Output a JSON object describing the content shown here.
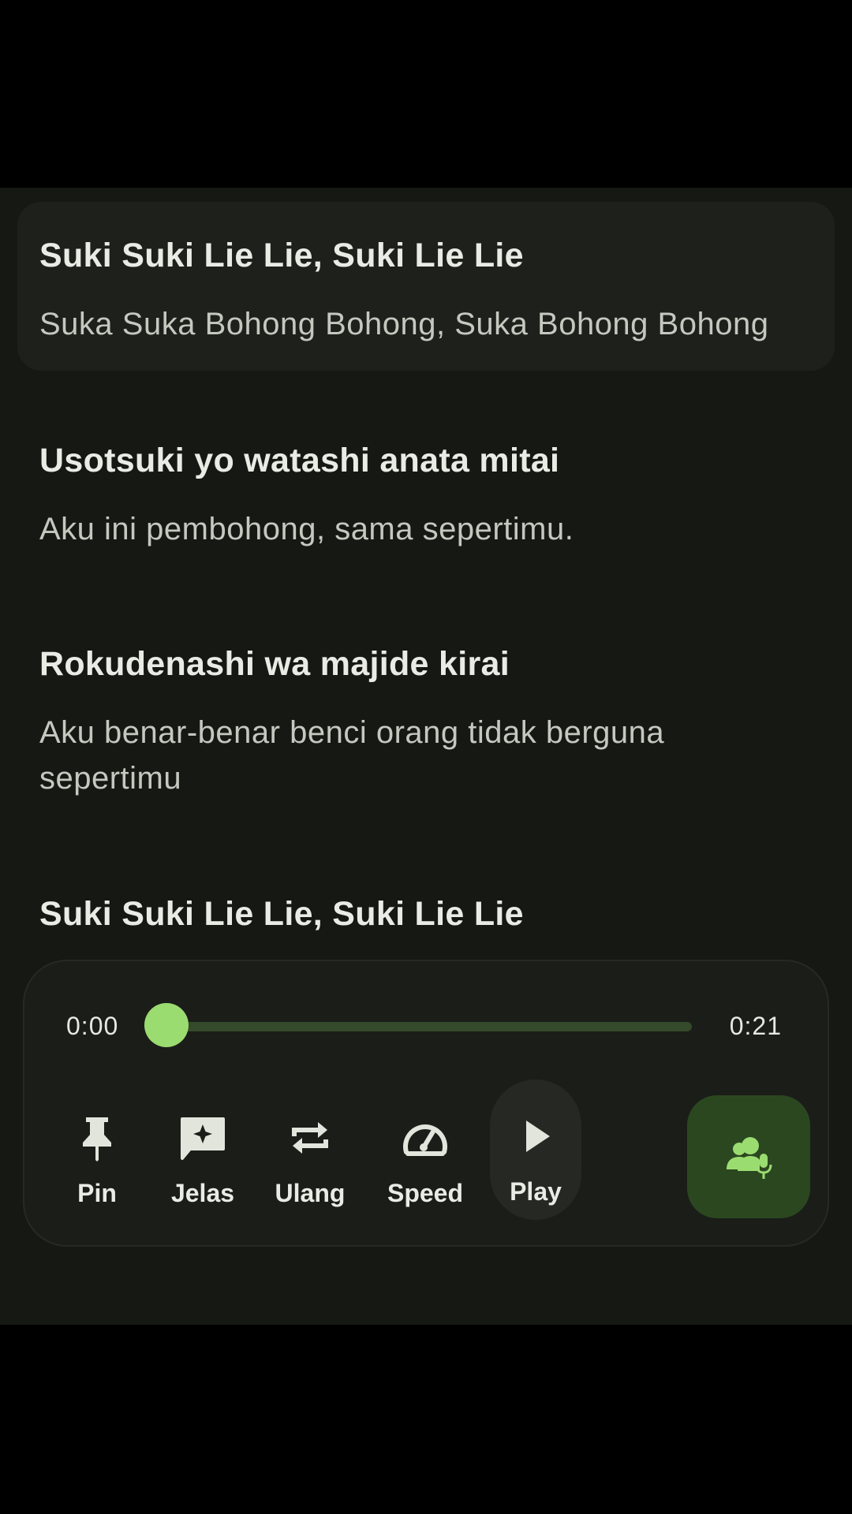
{
  "lyrics": [
    {
      "original": "Suki Suki Lie Lie, Suki Lie Lie",
      "translation": "Suka Suka Bohong Bohong, Suka Bohong Bohong",
      "active": true
    },
    {
      "original": "Usotsuki yo watashi anata mitai",
      "translation": "Aku ini pembohong, sama sepertimu."
    },
    {
      "original": "Rokudenashi wa majide kirai",
      "translation": "Aku benar-benar benci orang tidak berguna sepertimu"
    },
    {
      "original": "Suki Suki Lie Lie, Suki Lie Lie",
      "translation": ""
    }
  ],
  "player": {
    "current_time": "0:00",
    "total_time": "0:21",
    "progress_fraction": 0.0,
    "controls": {
      "pin": {
        "label": "Pin",
        "icon": "pin-icon"
      },
      "jelas": {
        "label": "Jelas",
        "icon": "sparkle-chat-icon"
      },
      "ulang": {
        "label": "Ulang",
        "icon": "repeat-icon"
      },
      "speed": {
        "label": "Speed",
        "icon": "speedometer-icon"
      },
      "play": {
        "label": "Play",
        "icon": "play-icon"
      }
    },
    "voice_button_icon": "group-mic-icon"
  },
  "colors": {
    "background": "#161814",
    "active_row": "#1d201b",
    "accent": "#9bdc70",
    "track": "#344a2a",
    "voice_button": "#2b4720"
  }
}
